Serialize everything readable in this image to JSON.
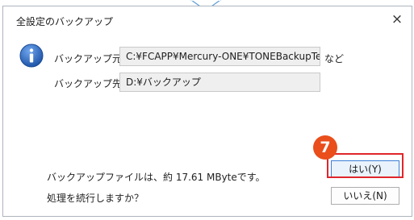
{
  "dialog": {
    "title": "全設定のバックアップ",
    "close_icon": "×"
  },
  "backup": {
    "source_label": "バックアップ元",
    "source_value": "C:¥FCAPP¥Mercury-ONE¥TONEBackupTe",
    "source_suffix": "など",
    "dest_label": "バックアップ先",
    "dest_value": "D:¥バックアップ"
  },
  "message": {
    "size_line": "バックアップファイルは、約 17.61 MByteです。",
    "confirm_line": "処理を続行しますか？"
  },
  "buttons": {
    "yes_label": "はい(Y)",
    "no_label": "いいえ(N)"
  },
  "annotation": {
    "step_number": "7"
  },
  "icons": {
    "info": "info-icon",
    "close": "close-icon"
  },
  "colors": {
    "highlight": "#e0262b",
    "badge": "#e94e1b",
    "info_blue": "#2a62b8",
    "pointer_border": "#5b9bd5"
  }
}
